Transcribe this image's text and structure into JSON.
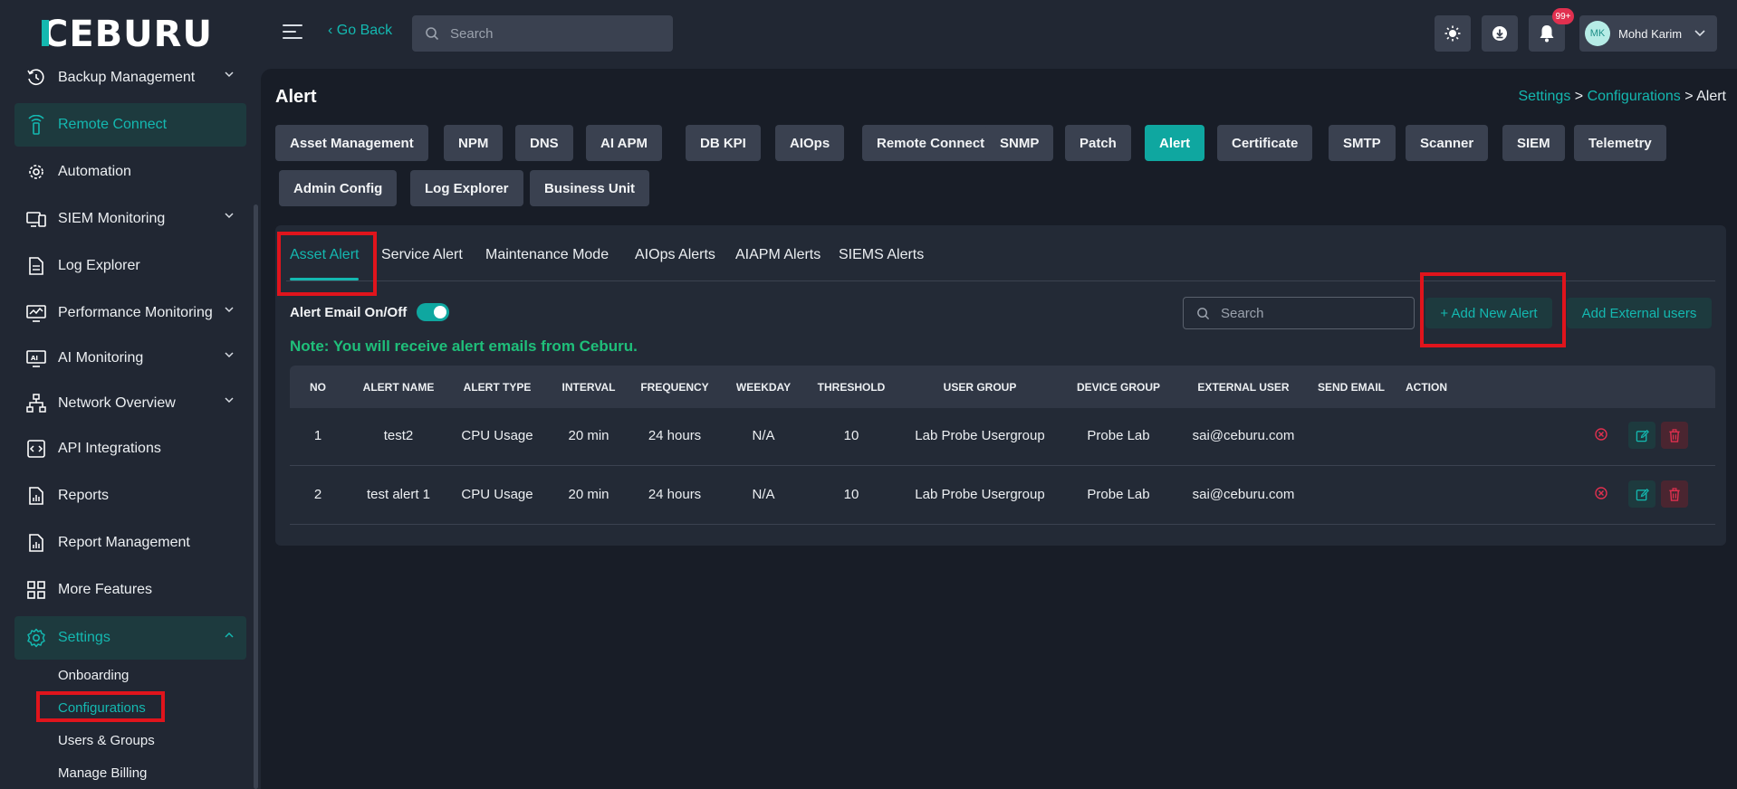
{
  "topbar": {
    "logo_text": "CEBURU",
    "go_back": "‹ Go Back",
    "search_placeholder": "Search",
    "notification_count": "99+",
    "user_initials": "MK",
    "user_name": "Mohd Karim"
  },
  "sidebar": {
    "items": [
      {
        "label": "Backup Management",
        "icon": "backup-icon",
        "chevron": true
      },
      {
        "label": "Remote Connect",
        "icon": "remote-icon",
        "active": true
      },
      {
        "label": "Automation",
        "icon": "automation-icon"
      },
      {
        "label": "SIEM Monitoring",
        "icon": "siem-icon",
        "chevron": true
      },
      {
        "label": "Log Explorer",
        "icon": "log-icon"
      },
      {
        "label": "Performance Monitoring",
        "icon": "performance-icon",
        "chevron": true
      },
      {
        "label": "AI Monitoring",
        "icon": "ai-icon",
        "chevron": true
      },
      {
        "label": "Network Overview",
        "icon": "network-icon",
        "chevron": true
      },
      {
        "label": "API Integrations",
        "icon": "api-icon"
      },
      {
        "label": "Reports",
        "icon": "report-icon"
      },
      {
        "label": "Report Management",
        "icon": "report-management-icon"
      },
      {
        "label": "More Features",
        "icon": "grid-icon"
      },
      {
        "label": "Settings",
        "icon": "gear-icon",
        "chevron": true,
        "expanded": true
      }
    ],
    "settings_sub": [
      "Onboarding",
      "Configurations",
      "Users & Groups",
      "Manage Billing"
    ],
    "active_sub": "Configurations"
  },
  "page": {
    "title": "Alert",
    "breadcrumb": {
      "a": "Settings",
      "sep": ">",
      "b": "Configurations",
      "c": "Alert"
    }
  },
  "config_tabs": [
    "Asset Management",
    "NPM",
    "DNS",
    "AI APM",
    "DB KPI",
    "AIOps",
    "Remote Connect",
    "SNMP",
    "Patch",
    "Alert",
    "Certificate",
    "SMTP",
    "Scanner",
    "SIEM",
    "Telemetry",
    "Admin Config",
    "Log Explorer",
    "Business Unit"
  ],
  "active_config_tab": "Alert",
  "alert_tabs": [
    "Asset Alert",
    "Service Alert",
    "Maintenance Mode",
    "AIOps Alerts",
    "AIAPM Alerts",
    "SIEMS Alerts"
  ],
  "active_alert_tab": "Asset Alert",
  "controls": {
    "email_toggle_label": "Alert Email On/Off",
    "email_toggle_on": true,
    "note": "Note: You will receive alert emails from Ceburu.",
    "search_placeholder": "Search",
    "add_new_alert": "+ Add New Alert",
    "add_external_users": "Add External users"
  },
  "table": {
    "headers": [
      "NO",
      "ALERT NAME",
      "ALERT TYPE",
      "INTERVAL",
      "FREQUENCY",
      "WEEKDAY",
      "THRESHOLD",
      "USER GROUP",
      "DEVICE GROUP",
      "EXTERNAL USER",
      "SEND EMAIL",
      "ACTION"
    ],
    "rows": [
      [
        "1",
        "test2",
        "CPU Usage",
        "20 min",
        "24 hours",
        "N/A",
        "10",
        "Lab Probe Usergroup",
        "Probe Lab",
        "sai@ceburu.com"
      ],
      [
        "2",
        "test alert 1",
        "CPU Usage",
        "20 min",
        "24 hours",
        "N/A",
        "10",
        "Lab Probe Usergroup",
        "Probe Lab",
        "sai@ceburu.com"
      ]
    ]
  },
  "colors": {
    "accent": "#14b8b0",
    "background": "#181d27",
    "panel": "#232a36",
    "highlight": "#e0141c",
    "note_green": "#1fbf7a",
    "danger": "#e1304f"
  }
}
